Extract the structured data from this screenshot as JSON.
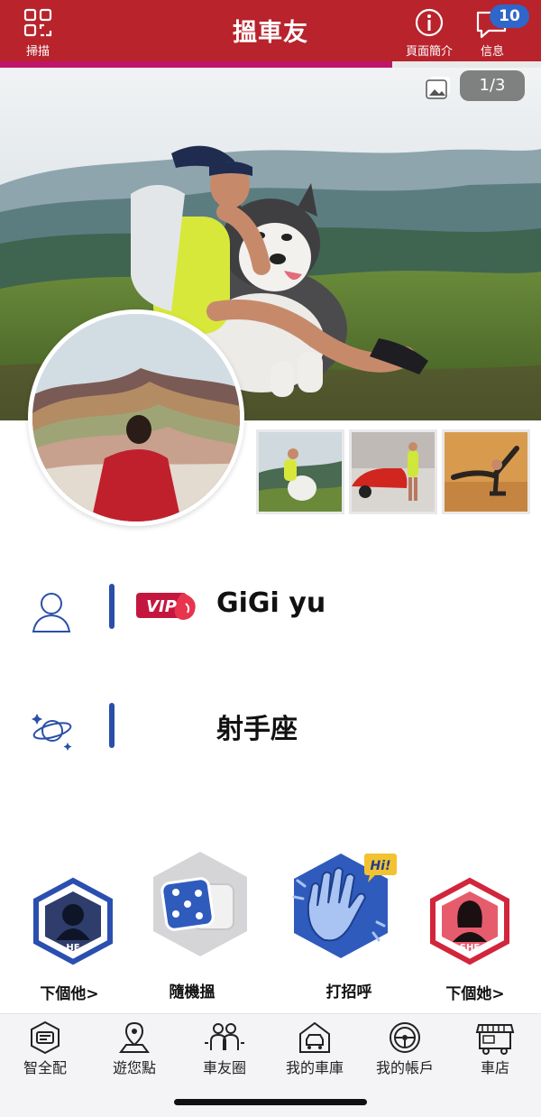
{
  "header": {
    "title": "搵車友",
    "scan_label": "掃描",
    "intro_label": "頁面簡介",
    "messages_label": "信息",
    "messages_badge": "10",
    "accent_color": "#b8232c"
  },
  "profile_progress": 0.725,
  "hero": {
    "page_indicator": "1/3",
    "gallery_count": 3
  },
  "profile": {
    "name": "GiGi yu",
    "vip_label": "VIP",
    "zodiac": "射手座"
  },
  "actions": {
    "next_him": "下個他>",
    "random": "隨機搵",
    "greet": "打招呼",
    "greet_badge": "Hi!",
    "next_her": "下個她>",
    "he_label": "HE",
    "she_label": "SHE"
  },
  "nav": {
    "items": [
      {
        "label": "智全配",
        "icon": "id-card-icon"
      },
      {
        "label": "遊您點",
        "icon": "map-pin-icon"
      },
      {
        "label": "車友圈",
        "icon": "friends-icon"
      },
      {
        "label": "我的車庫",
        "icon": "garage-icon"
      },
      {
        "label": "我的帳戶",
        "icon": "steering-wheel-icon"
      },
      {
        "label": "車店",
        "icon": "shop-icon"
      }
    ]
  }
}
